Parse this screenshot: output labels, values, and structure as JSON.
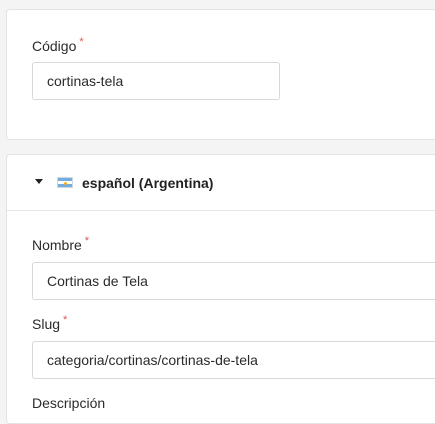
{
  "code_field": {
    "label": "Código",
    "required_mark": "*",
    "value": "cortinas-tela"
  },
  "translation_section": {
    "language_label": "español (Argentina)",
    "flag_icon": "argentina-flag-icon",
    "expanded": true,
    "name_field": {
      "label": "Nombre",
      "required_mark": "*",
      "value": "Cortinas de Tela"
    },
    "slug_field": {
      "label": "Slug",
      "required_mark": "*",
      "value": "categoria/cortinas/cortinas-de-tela"
    },
    "description_field": {
      "label": "Descripción"
    }
  },
  "colors": {
    "required": "#e25555",
    "flag_blue": "#74acdf",
    "flag_sun": "#f6b40e"
  }
}
